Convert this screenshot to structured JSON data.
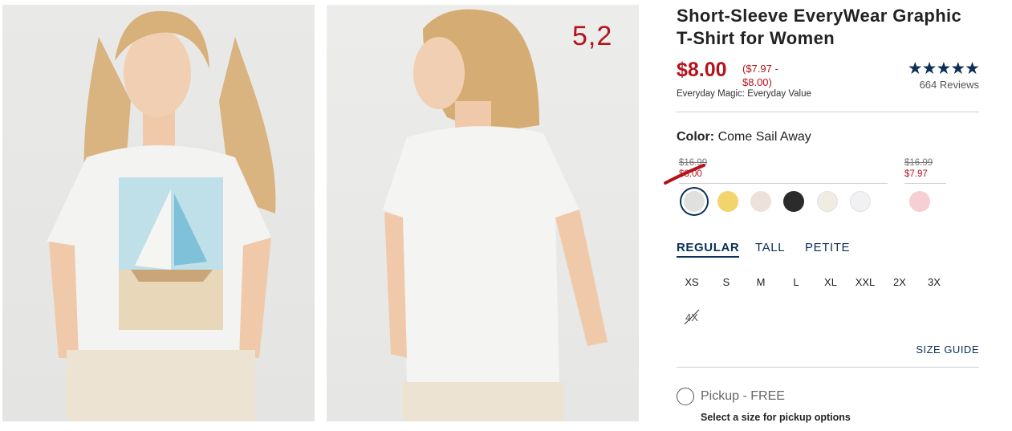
{
  "annotation": "5,2",
  "images": {
    "front_alt": "",
    "back_alt": ""
  },
  "product": {
    "title": "Short-Sleeve EveryWear Graphic T-Shirt for Women",
    "price": "$8.00",
    "price_range": "($7.97 - $8.00)",
    "tagline": "Everyday Magic: Everyday Value",
    "stars": "★★★★★",
    "rating": 4.8,
    "reviews": "664 Reviews"
  },
  "color": {
    "label": "Color:",
    "value": "Come Sail Away",
    "groups": [
      {
        "old_price": "$16.99",
        "new_price": "$8.00"
      },
      {
        "old_price": "$16.99",
        "new_price": "$7.97"
      }
    ],
    "swatches": [
      {
        "name": "come-sail-away",
        "color": "#e0e0de",
        "selected": true
      },
      {
        "name": "yellow",
        "color": "#f3d36b"
      },
      {
        "name": "blush",
        "color": "#ede2db"
      },
      {
        "name": "black",
        "color": "#2b2b2b"
      },
      {
        "name": "cream",
        "color": "#efede1"
      },
      {
        "name": "white",
        "color": "#f1f1f3"
      },
      {
        "name": "pink-tie-dye",
        "color": "#f6cfd3"
      }
    ]
  },
  "fit": {
    "tabs": [
      "REGULAR",
      "TALL",
      "PETITE"
    ],
    "active": "REGULAR"
  },
  "sizes": [
    "XS",
    "S",
    "M",
    "L",
    "XL",
    "XXL",
    "2X",
    "3X",
    "4X"
  ],
  "unavailable_sizes": [
    "4X"
  ],
  "size_guide": "SIZE GUIDE",
  "pickup": {
    "label": "Pickup - FREE",
    "sub": "Select a size for pickup options"
  },
  "colors": {
    "accent_red": "#b5121b",
    "navy": "#0b2f57"
  }
}
